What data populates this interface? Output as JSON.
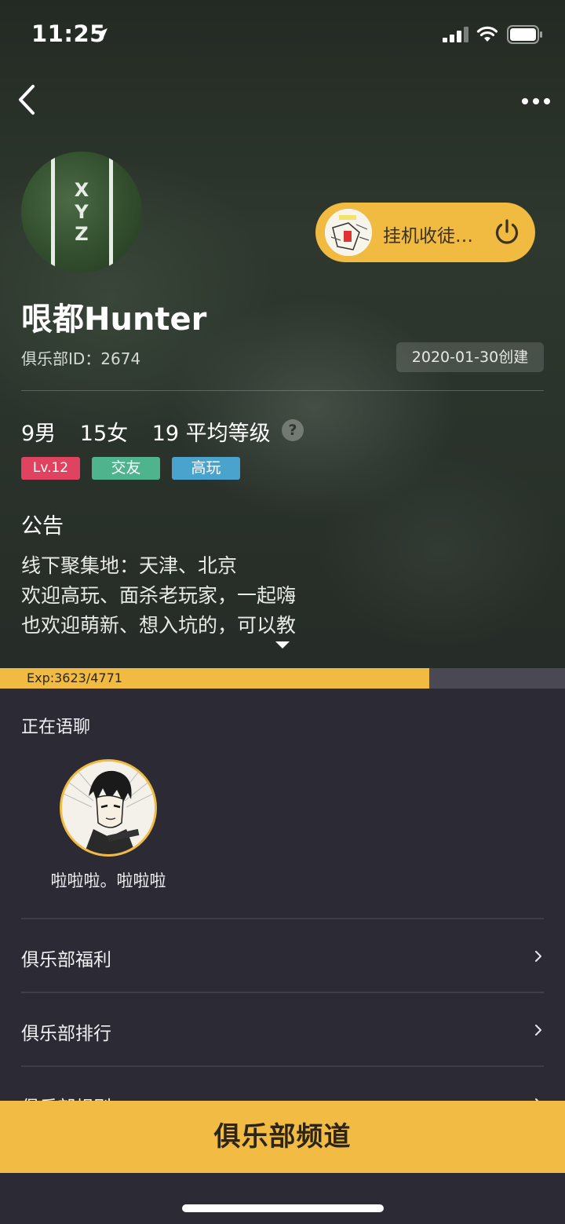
{
  "status_bar": {
    "time": "11:25"
  },
  "header": {
    "back_icon": "chevron-left-icon",
    "more_icon": "more-dots-icon"
  },
  "club": {
    "name": "哏都Hunter",
    "id_text": "俱乐部ID：2674",
    "created": "2020-01-30创建",
    "avatar_letters": [
      "X",
      "Y",
      "Z"
    ]
  },
  "idle_pill": {
    "label": "挂机收徒…",
    "icon": "power-icon"
  },
  "stats": {
    "male": "9男",
    "female": "15女",
    "avg_level": "19 平均等级",
    "help": "?"
  },
  "tags": [
    {
      "label": "Lv.12",
      "color": "#e0435f"
    },
    {
      "label": "交友",
      "color": "#4fb48e"
    },
    {
      "label": "高玩",
      "color": "#4aa3cc"
    }
  ],
  "notice": {
    "title": "公告",
    "lines": [
      "线下聚集地：天津、北京",
      "欢迎高玩、面杀老玩家，一起嗨",
      "也欢迎萌新、想入坑的，可以教"
    ]
  },
  "exp": {
    "text": "Exp:3623/4771",
    "current": 3623,
    "max": 4771
  },
  "voice": {
    "title": "正在语聊",
    "member_name": "啦啦啦。啦啦啦"
  },
  "menu": [
    {
      "label": "俱乐部福利"
    },
    {
      "label": "俱乐部排行"
    },
    {
      "label": "俱乐部规则"
    }
  ],
  "channel_button": {
    "label": "俱乐部频道"
  },
  "colors": {
    "accent": "#f1bb42",
    "panel_bg": "#2c2a35"
  }
}
